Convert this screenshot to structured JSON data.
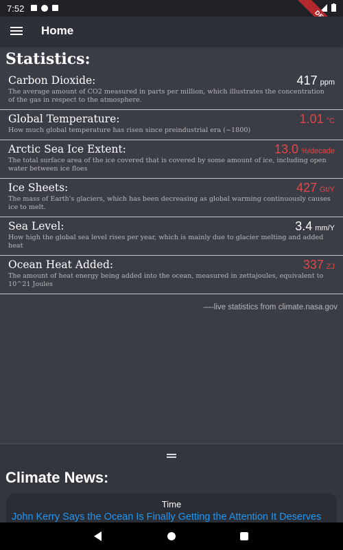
{
  "status_bar": {
    "time": "7:52"
  },
  "debug_banner": "DEBUG",
  "app_bar": {
    "title": "Home"
  },
  "statistics": {
    "title": "Statistics:",
    "items": [
      {
        "name": "Carbon Dioxide:",
        "value": "417",
        "unit": "ppm",
        "color": "#ffffff",
        "description": "The average amount of CO2 measured in parts per million, which illustrates the concentration of the gas in respect to the atmosphere."
      },
      {
        "name": "Global Temperature:",
        "value": "1.01",
        "unit": "°C",
        "color": "#e64646",
        "description": "How much global temperature has risen since preindustrial era (~1800)"
      },
      {
        "name": "Arctic Sea Ice Extent:",
        "value": "13.0",
        "unit": "%/decade",
        "color": "#e64646",
        "description": "The total surface area of the ice covered that is covered by some amount of ice, including open water between ice floes"
      },
      {
        "name": "Ice Sheets:",
        "value": "427",
        "unit": "Gt/Y",
        "color": "#e64646",
        "description": "The mass of Earth's glaciers, which has been decreasing as global warming continuously causes ice to melt."
      },
      {
        "name": "Sea Level:",
        "value": "3.4",
        "unit": "mm/Y",
        "color": "#ffffff",
        "description": "How high the global sea level rises per year, which is mainly due to glacier melting and added heat"
      },
      {
        "name": "Ocean Heat Added:",
        "value": "337",
        "unit": "ZJ",
        "color": "#e64646",
        "description": "The amount of heat energy being added into the ocean, measured in zettajoules, equivalent to 10^21 Joules"
      }
    ],
    "source_note": "—-live statistics from climate.nasa.gov"
  },
  "news": {
    "title": "Climate News:",
    "cards": [
      {
        "source": "Time",
        "headline": "John Kerry Says the Ocean Is Finally Getting the Attention It Deserves"
      }
    ]
  }
}
